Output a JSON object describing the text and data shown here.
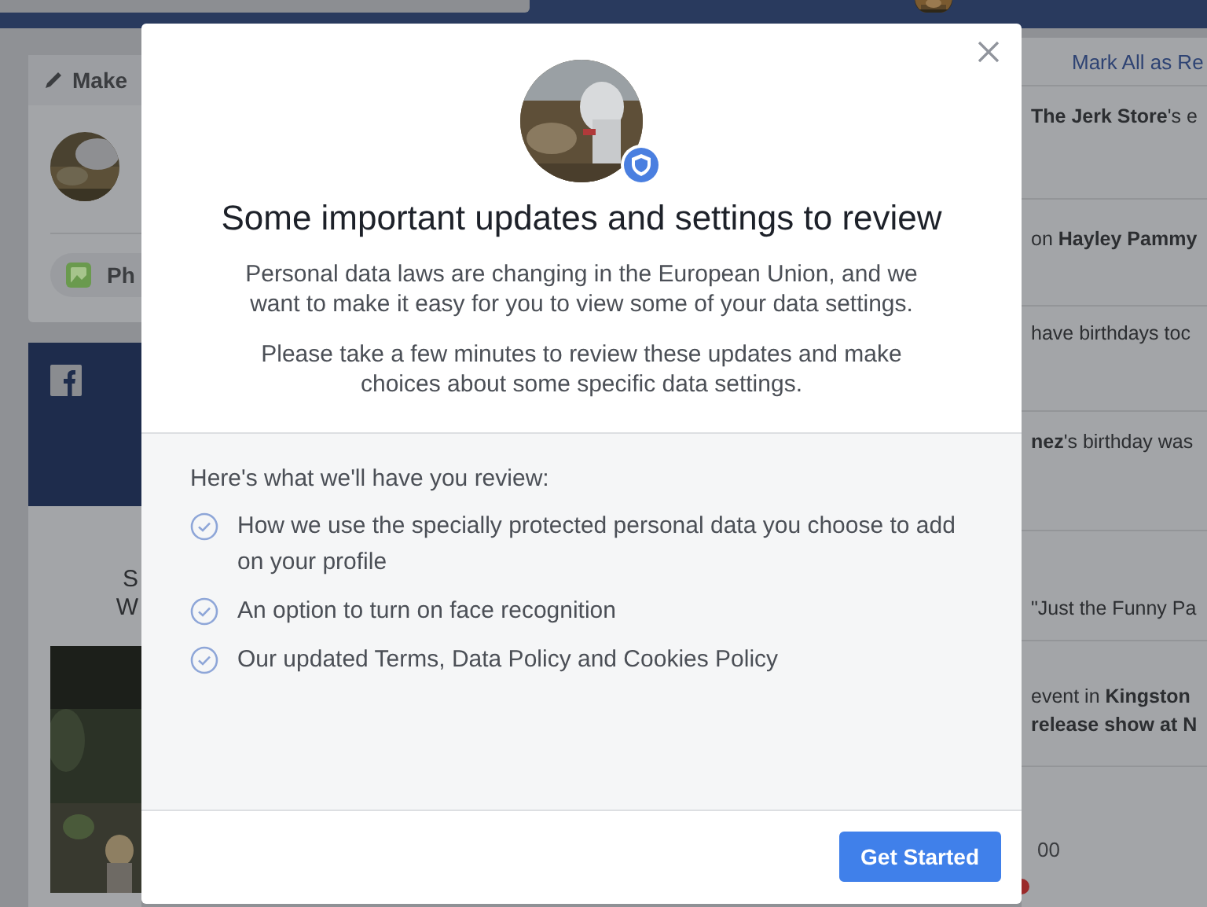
{
  "composer": {
    "tab_label": "Make",
    "photo_button": "Ph"
  },
  "page_card": {
    "lines": [
      "S",
      "W"
    ]
  },
  "notifications": {
    "mark_all": "Mark All as Re",
    "items": [
      {
        "text": "**The Jerk Store**'s e"
      },
      {
        "text": "on **Hayley Pammy**"
      },
      {
        "text": "have birthdays toc"
      },
      {
        "text": "**nez**'s birthday was"
      },
      {
        "text": "\"Just the Funny Pa"
      },
      {
        "text": "event in **Kingston**\n**release show at N**"
      }
    ],
    "reaction_count": "00"
  },
  "dialog": {
    "title": "Some important updates and settings to review",
    "paragraphs": [
      "Personal data laws are changing in the European Union, and we want to make it easy for you to view some of your data settings.",
      "Please take a few minutes to review these updates and make choices about some specific data settings."
    ],
    "review_heading": "Here's what we'll have you review:",
    "review_items": [
      "How we use the specially protected personal data you choose to add on your profile",
      "An option to turn on face recognition",
      "Our updated Terms, Data Policy and Cookies Policy"
    ],
    "button": "Get Started"
  }
}
